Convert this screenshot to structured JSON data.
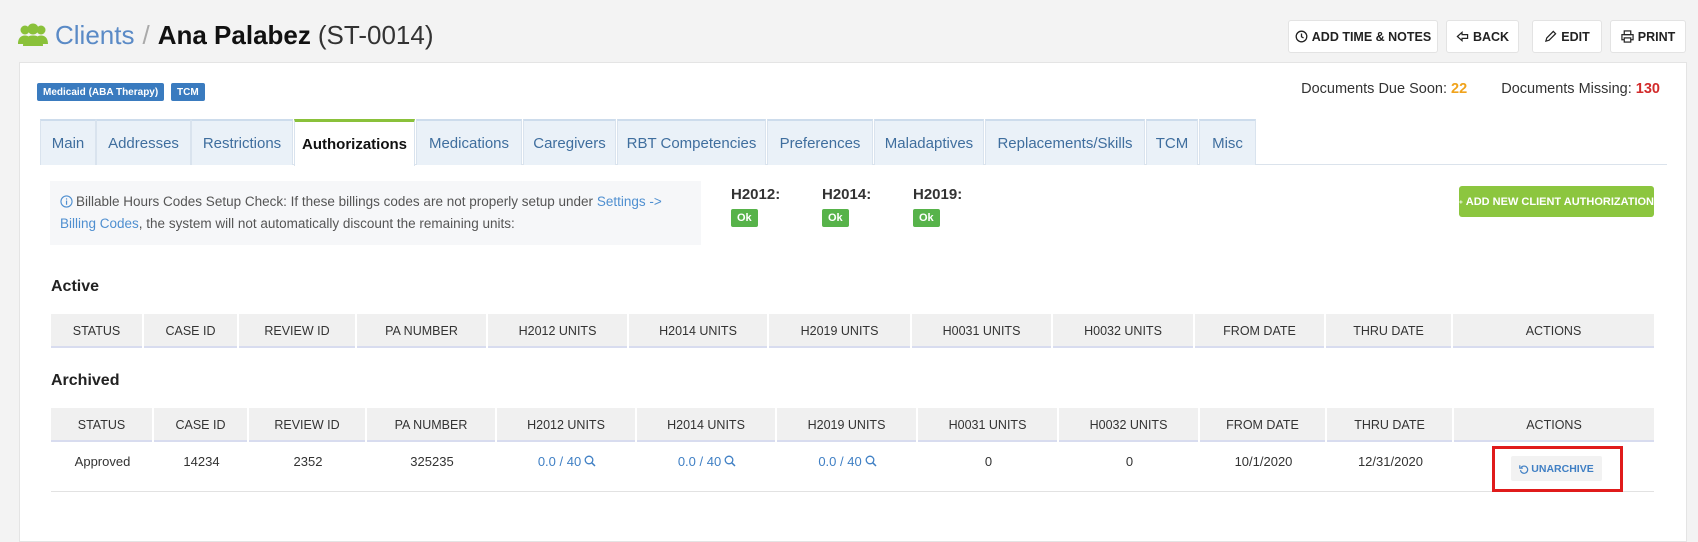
{
  "header": {
    "breadcrumb": "Clients",
    "separator": "/",
    "client_name": "Ana Palabez",
    "client_code": "(ST-0014)",
    "buttons": {
      "add_time": "ADD TIME & NOTES",
      "back": "BACK",
      "edit": "EDIT",
      "print": "PRINT"
    }
  },
  "badges": [
    "Medicaid (ABA Therapy)",
    "TCM"
  ],
  "documents": {
    "due_soon_label": "Documents Due Soon:",
    "due_soon_value": "22",
    "missing_label": "Documents Missing:",
    "missing_value": "130"
  },
  "tabs": [
    "Main",
    "Addresses",
    "Restrictions",
    "Authorizations",
    "Medications",
    "Caregivers",
    "RBT Competencies",
    "Preferences",
    "Maladaptives",
    "Replacements/Skills",
    "TCM",
    "Misc"
  ],
  "active_tab": "Authorizations",
  "info": {
    "text_before": "Billable Hours Codes Setup Check: If these billings codes are not properly setup under",
    "link1": "Settings ->",
    "link2": "Billing Codes",
    "text_after": ", the system will not automatically discount the remaining units:"
  },
  "codes": [
    {
      "label": "H2012:",
      "status": "Ok"
    },
    {
      "label": "H2014:",
      "status": "Ok"
    },
    {
      "label": "H2019:",
      "status": "Ok"
    }
  ],
  "add_auth_button": "ADD NEW CLIENT AUTHORIZATION",
  "active_section": {
    "title": "Active",
    "columns": [
      "STATUS",
      "CASE ID",
      "REVIEW ID",
      "PA NUMBER",
      "H2012 UNITS",
      "H2014 UNITS",
      "H2019 UNITS",
      "H0031 UNITS",
      "H0032 UNITS",
      "FROM DATE",
      "THRU DATE",
      "ACTIONS"
    ]
  },
  "archived_section": {
    "title": "Archived",
    "columns": [
      "STATUS",
      "CASE ID",
      "REVIEW ID",
      "PA NUMBER",
      "H2012 UNITS",
      "H2014 UNITS",
      "H2019 UNITS",
      "H0031 UNITS",
      "H0032 UNITS",
      "FROM DATE",
      "THRU DATE",
      "ACTIONS"
    ],
    "rows": [
      {
        "status": "Approved",
        "case_id": "14234",
        "review_id": "2352",
        "pa_number": "325235",
        "h2012": "0.0 / 40",
        "h2014": "0.0 / 40",
        "h2019": "0.0 / 40",
        "h0031": "0",
        "h0032": "0",
        "from_date": "10/1/2020",
        "thru_date": "12/31/2020",
        "action": "UNARCHIVE"
      }
    ]
  },
  "colors": {
    "accent_green": "#8cc63f",
    "link_blue": "#3f7fc4",
    "badge_blue": "#3a7bbf",
    "due_soon": "#f0a31c",
    "missing": "#d22b2b",
    "highlight": "#e01b1b"
  }
}
